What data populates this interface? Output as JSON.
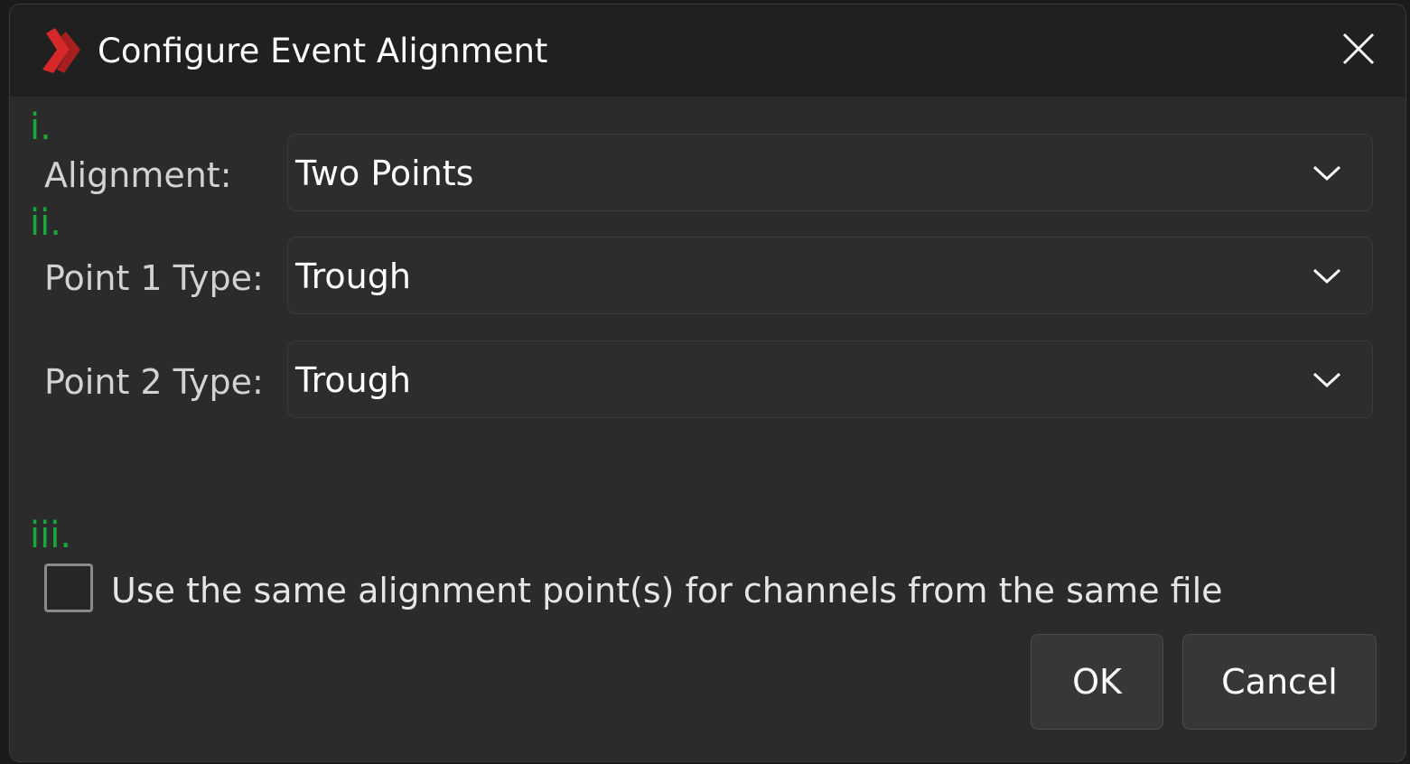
{
  "dialog": {
    "title": "Configure Event Alignment",
    "logo_icon": "app-logo-chevron-icon",
    "close_icon": "close-icon",
    "accent_color": "#d62828",
    "marker_color": "#18a83a"
  },
  "markers": {
    "first": "i.",
    "second": "ii.",
    "third": "iii."
  },
  "fields": {
    "alignment": {
      "label": "Alignment:",
      "value": "Two Points"
    },
    "point1": {
      "label": "Point 1 Type:",
      "value": "Trough"
    },
    "point2": {
      "label": "Point 2 Type:",
      "value": "Trough"
    }
  },
  "same_file_option": {
    "label": "Use the same alignment point(s) for channels from the same file",
    "checked": false
  },
  "buttons": {
    "ok": "OK",
    "cancel": "Cancel"
  }
}
